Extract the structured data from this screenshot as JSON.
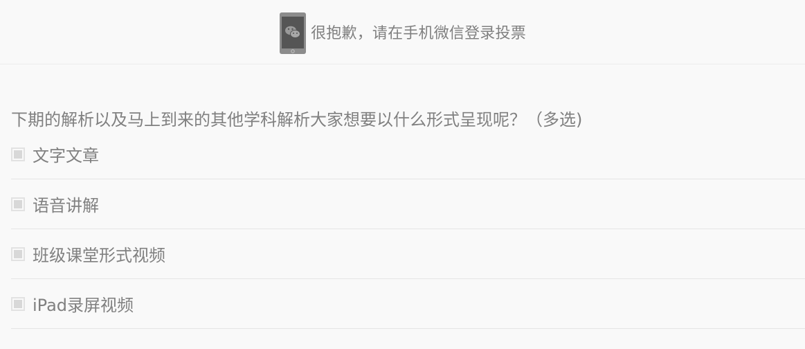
{
  "notice": {
    "icon": "wechat-phone-icon",
    "text": "很抱歉，请在手机微信登录投票"
  },
  "question": {
    "title": "下期的解析以及马上到来的其他学科解析大家想要以什么形式呈现呢？（多选)",
    "options": [
      {
        "label": "文字文章",
        "checked": false
      },
      {
        "label": "语音讲解",
        "checked": false
      },
      {
        "label": "班级课堂形式视频",
        "checked": false
      },
      {
        "label": "iPad录屏视频",
        "checked": false
      }
    ]
  },
  "colors": {
    "background": "#f9f9f9",
    "text": "#808080",
    "phone": "#8c8c8c",
    "divider": "#e5e5e5"
  }
}
